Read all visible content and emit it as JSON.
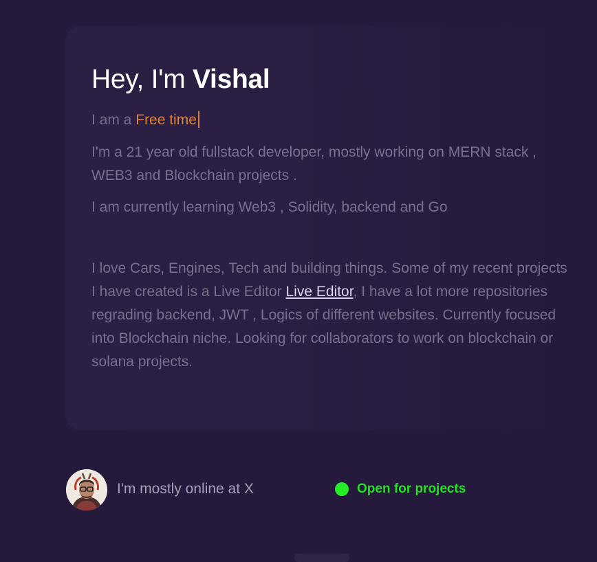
{
  "hero": {
    "greeting": "Hey, I'm ",
    "name": "Vishal",
    "role_prefix": "I am a ",
    "role_typed": "Free time",
    "intro": "I'm a 21 year old fullstack developer, mostly working on MERN stack , WEB3 and Blockchain projects .",
    "learning": "I am currently learning Web3 , Solidity, backend and Go",
    "about_part1": "I love Cars, Engines, Tech and building things. Some of my recent projects I have created is a Live Editor ",
    "about_link": "Live Editor",
    "about_part2": ", I have a lot more repositories regrading backend, JWT , Logics of different websites. Currently focused into Blockchain niche. Looking for collaborators to work on blockchain or solana projects."
  },
  "footer": {
    "online_text": "I'm mostly online at X",
    "status_label": "Open for projects"
  },
  "colors": {
    "background": "#251a3b",
    "accent_orange": "#d9823c",
    "status_green": "#26ee26",
    "muted_text": "#77718d"
  }
}
